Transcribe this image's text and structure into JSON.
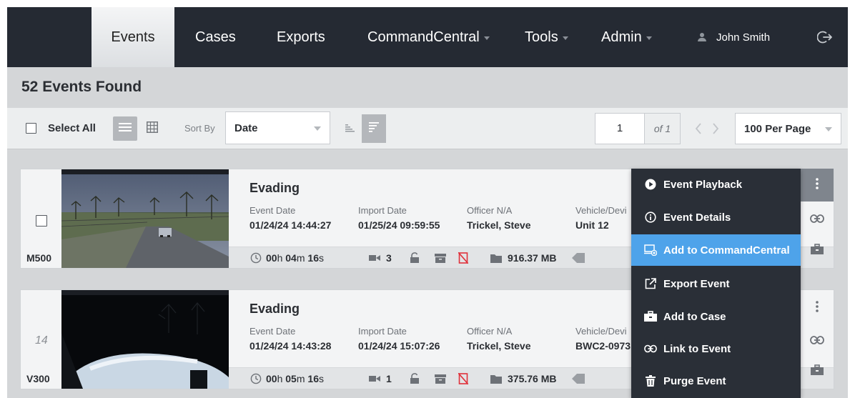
{
  "nav": {
    "items": [
      {
        "label": "Events",
        "dropdown": false,
        "active": true
      },
      {
        "label": "Cases",
        "dropdown": false,
        "active": false
      },
      {
        "label": "Exports",
        "dropdown": false,
        "active": false
      },
      {
        "label": "CommandCentral",
        "dropdown": true,
        "active": false
      },
      {
        "label": "Tools",
        "dropdown": true,
        "active": false
      },
      {
        "label": "Admin",
        "dropdown": true,
        "active": false
      }
    ],
    "user_name": "John Smith",
    "user_icon": "user-icon",
    "logout_icon": "logout-icon"
  },
  "results": {
    "count_label": "52 Events Found"
  },
  "toolbar": {
    "select_all_label": "Select All",
    "list_view_icon": "list-view-icon",
    "grid_view_icon": "grid-view-icon",
    "sort_by_label": "Sort By",
    "sort_value": "Date",
    "sort_asc_icon": "sort-ascending-icon",
    "sort_desc_icon": "sort-descending-icon",
    "page_value": "1",
    "page_of": "of 1",
    "per_page_value": "100 Per Page"
  },
  "events": [
    {
      "title": "Evading",
      "device": "M500",
      "index_label": "",
      "event_date_label": "Event Date",
      "event_date": "01/24/24 14:44:27",
      "import_date_label": "Import Date",
      "import_date": "01/25/24 09:59:55",
      "officer_label": "Officer N/A",
      "officer": "Trickel, Steve",
      "vehicle_label": "Vehicle/Devi",
      "vehicle": "Unit 12",
      "duration_h": "00",
      "duration_m": "04",
      "duration_s": "16",
      "video_count": "3",
      "size": "916.37 MB"
    },
    {
      "title": "Evading",
      "device": "V300",
      "index_label": "14",
      "event_date_label": "Event Date",
      "event_date": "01/24/24 14:43:28",
      "import_date_label": "Import Date",
      "import_date": "01/24/24 15:07:26",
      "officer_label": "Officer N/A",
      "officer": "Trickel, Steve",
      "vehicle_label": "Vehicle/Devi",
      "vehicle": "BWC2-0973",
      "duration_h": "00",
      "duration_m": "05",
      "duration_s": "16",
      "video_count": "1",
      "size": "375.76 MB"
    }
  ],
  "units": {
    "h": "h",
    "m": "m",
    "s": "s"
  },
  "context_menu": {
    "items": [
      {
        "label": "Event Playback",
        "icon": "play-circle-icon",
        "highlighted": false
      },
      {
        "label": "Event Details",
        "icon": "info-circle-icon",
        "highlighted": false
      },
      {
        "label": "Add to CommandCentral",
        "icon": "add-to-commandcentral-icon",
        "highlighted": true
      },
      {
        "label": "Export Event",
        "icon": "export-icon",
        "highlighted": false
      },
      {
        "label": "Add to Case",
        "icon": "briefcase-icon",
        "highlighted": false
      },
      {
        "label": "Link to Event",
        "icon": "link-icon",
        "highlighted": false
      },
      {
        "label": "Purge Event",
        "icon": "trash-icon",
        "highlighted": false
      }
    ]
  },
  "colors": {
    "nav_bg": "#252a33",
    "menu_bg": "#2a2f37",
    "menu_highlight": "#4ea3ea",
    "restricted_red": "#e0313b"
  }
}
